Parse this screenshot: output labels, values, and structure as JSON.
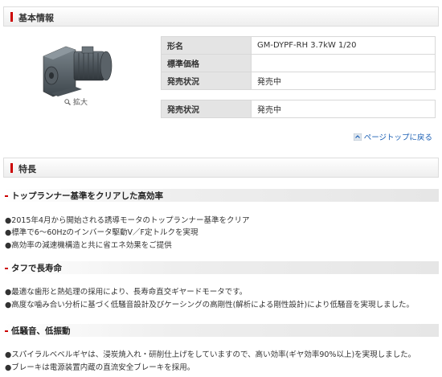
{
  "basic_info": {
    "header_title": "基本情報",
    "zoom_label": "拡大",
    "rows": [
      {
        "label": "形名",
        "value": "GM-DYPF-RH 3.7kW 1/20"
      },
      {
        "label": "標準価格",
        "value": ""
      },
      {
        "label": "発売状況",
        "value": "発売中"
      }
    ],
    "extra_row": {
      "label": "発売状況",
      "value": "発売中"
    },
    "page_top_label": "ページトップに戻る"
  },
  "features": {
    "header_title": "特長",
    "sections": [
      {
        "title": "トップランナー基準をクリアした高効率",
        "bullets": [
          "●2015年4月から開始される誘導モータのトップランナー基準をクリア",
          "●標準で6～60Hzのインバータ駆動V／F定トルクを実現",
          "●高効率の減速機構造と共に省エネ効果をご提供"
        ]
      },
      {
        "title": "タフで長寿命",
        "bullets": [
          "●最適な歯形と熱処理の採用により、長寿命直交ギヤードモータです。",
          "●高度な噛み合い分析に基づく低騒音設計及びケーシングの高剛性(解析による剛性設計)により低騒音を実現しました。"
        ]
      },
      {
        "title": "低騒音、低振動",
        "bullets": [
          "●スパイラルベベルギヤは、浸炭焼入れ・研削仕上げをしていますので、高い効率(ギヤ効率90%以上)を実現しました。",
          "●ブレーキは電源装置内蔵の直流安全ブレーキを採用。"
        ]
      }
    ]
  },
  "colors": {
    "accent_red": "#cc0000",
    "link_blue": "#1a5fb4",
    "table_header_bg": "#e4e4e4"
  },
  "icons": [
    "magnifier-icon",
    "page-top-arrow-icon",
    "product-image"
  ]
}
